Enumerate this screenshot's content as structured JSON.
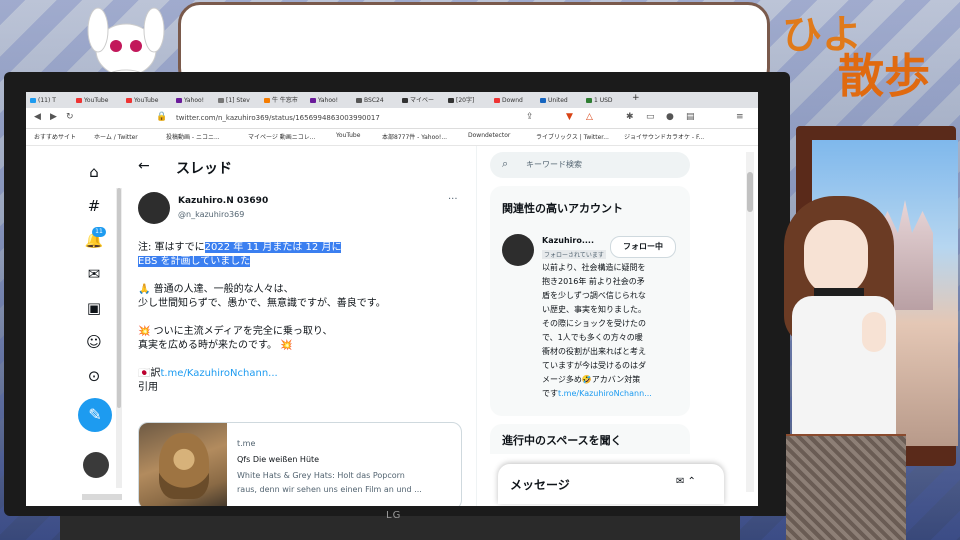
{
  "overlay": {
    "title_line1": "ひよ",
    "title_line2": "散歩"
  },
  "monitor": {
    "brand": "LG"
  },
  "browser": {
    "tabs": [
      "(11) T",
      "YouTube",
      "YouTube",
      "Yahoo!",
      "[1] Stev",
      "牛 牛窓市",
      "Yahoo!",
      "BSC24",
      "マイベー",
      "[20字]",
      "Downd",
      "United",
      "1 USD",
      "+"
    ],
    "url": "twitter.com/n_kazuhiro369/status/1656994863003990017",
    "bookmarks": [
      "おすすめサイト",
      "ホーム / Twitter",
      "投稿動画 - ニコニ...",
      "マイページ 動画ニコレ...",
      "YouTube",
      "本部8777件 - Yahoo!...",
      "Downdetector",
      "ライブリックス | Twitter...",
      "ジョイサウンドカラオケ - F..."
    ]
  },
  "leftnav": {
    "icons": [
      "home-icon",
      "explore-icon",
      "notifications-icon",
      "messages-icon",
      "bookmarks-icon",
      "profile-icon",
      "more-icon"
    ],
    "notification_count": "11"
  },
  "main": {
    "back": "←",
    "title": "スレッド",
    "tweet": {
      "name": "Kazuhiro.N 03690",
      "handle": "@n_kazuhiro369",
      "more": "···",
      "line1_pre": "注: 軍はすでに",
      "line1_hl": "2022 年 11 月または 12 月に",
      "line2_hl": "EBS を計画していました",
      "line3": "🙏 普通の人達、一般的な人々は、",
      "line4": "少し世間知らずで、愚かで、無意識ですが、善良です。",
      "line5": "💥 ついに主流メディアを完全に乗っ取り、",
      "line6": "真実を広める時が来たのです。 💥",
      "line7_pre": "🇯🇵訳",
      "line7_link": "t.me/KazuhiroNchann...",
      "line8": "引用",
      "card": {
        "domain": "t.me",
        "title": "Qfs Die weißen Hüte",
        "desc1": "White Hats & Grey Hats: Holt das Popcorn",
        "desc2": "raus, denn wir sehen uns einen Film an und ..."
      }
    }
  },
  "sidebar": {
    "search_placeholder": "キーワード検索",
    "panel_title": "関連性の高いアカウント",
    "account_name": "Kazuhiro....",
    "follows_you": "フォローされています",
    "follow_button": "フォロー中",
    "bio": [
      "以前より、社会構造に疑問を",
      "抱き2016年 前より社会の矛",
      "盾を少しずつ調べ信じられな",
      "い歴史、事実を知りました。",
      "その際にショックを受けたの",
      "で、1人でも多くの方々の暖",
      "衝材の役割が出来ればと考え",
      "ていますが今は受けるのはダ",
      "メージ多め🤣アカバン対策",
      "です"
    ],
    "bio_link": "t.me/KazuhiroNchann...",
    "spaces_title": "進行中のスペースを聞く",
    "messages_title": "メッセージ"
  }
}
